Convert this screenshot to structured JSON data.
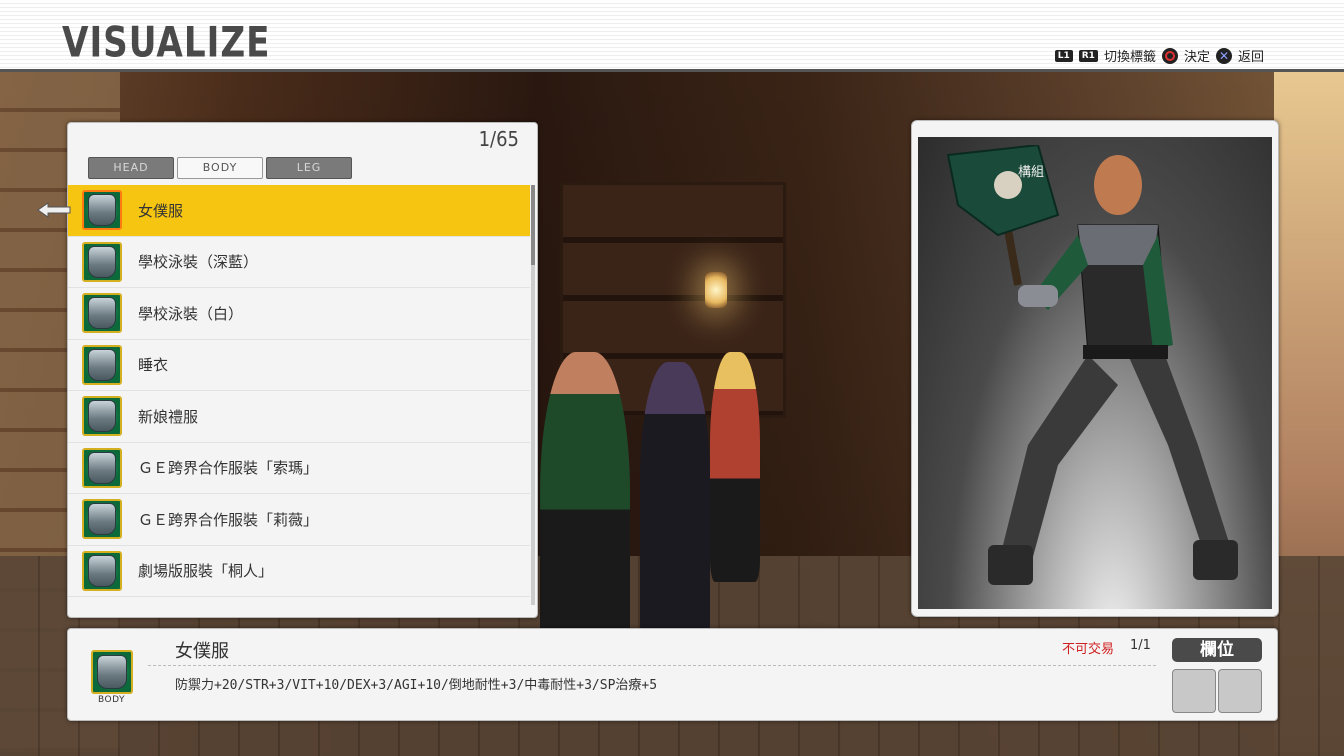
{
  "header": {
    "title": "VISUALIZE",
    "hints": {
      "l1": "L1",
      "r1": "R1",
      "switch_tab": "切換標籤",
      "confirm": "決定",
      "back": "返回"
    }
  },
  "list": {
    "counter": "1/65",
    "tabs": [
      {
        "label": "HEAD",
        "active": false
      },
      {
        "label": "BODY",
        "active": true
      },
      {
        "label": "LEG",
        "active": false
      }
    ],
    "items": [
      {
        "name": "女僕服",
        "icon": "armor-icon",
        "selected": true
      },
      {
        "name": "學校泳裝（深藍）",
        "icon": "armor-icon",
        "selected": false
      },
      {
        "name": "學校泳裝（白）",
        "icon": "armor-icon",
        "selected": false
      },
      {
        "name": "睡衣",
        "icon": "armor-icon",
        "selected": false
      },
      {
        "name": "新娘禮服",
        "icon": "armor-icon",
        "selected": false
      },
      {
        "name": "ＧＥ跨界合作服裝「索瑪」",
        "icon": "armor-icon",
        "selected": false
      },
      {
        "name": "ＧＥ跨界合作服裝「莉薇」",
        "icon": "armor-icon",
        "selected": false
      },
      {
        "name": "劇場版服裝「桐人」",
        "icon": "armor-icon",
        "selected": false
      }
    ]
  },
  "preview": {
    "set_label": "構組"
  },
  "info": {
    "name": "女僕服",
    "category": "BODY",
    "stats": "防禦力+20/STR+3/VIT+10/DEX+3/AGI+10/倒地耐性+3/中毒耐性+3/SP治療+5",
    "trade": "不可交易",
    "quantity": "1/1",
    "slot_label": "欄位"
  },
  "colors": {
    "selected_row": "#f6c512",
    "trade_red": "#d02020",
    "icon_frame": "#d4b020"
  }
}
